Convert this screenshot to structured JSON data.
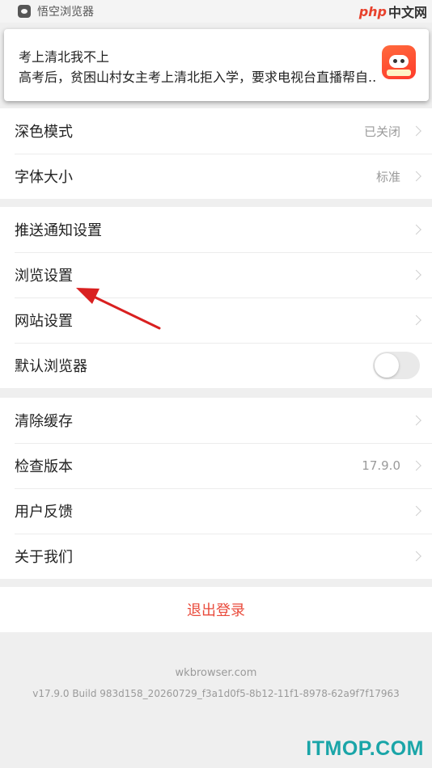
{
  "status_bar": {
    "app_name": "悟空浏览器",
    "app_icon": "app-icon"
  },
  "watermark_top": {
    "php": "php",
    "cn": "中文网"
  },
  "notification": {
    "title": "考上清北我不上",
    "body": "高考后，贫困山村女主考上清北拒入学，要求电视台直播帮自..",
    "icon": "app-promo-icon",
    "icon_color": "#ff4a31"
  },
  "display_group": {
    "items": [
      {
        "label": "深色模式",
        "value": "已关闭"
      },
      {
        "label": "字体大小",
        "value": "标准"
      }
    ]
  },
  "settings_group": {
    "items": [
      {
        "label": "推送通知设置"
      },
      {
        "label": "浏览设置"
      },
      {
        "label": "网站设置"
      },
      {
        "label": "默认浏览器",
        "toggle": false
      }
    ]
  },
  "misc_group": {
    "items": [
      {
        "label": "清除缓存"
      },
      {
        "label": "检查版本",
        "value": "17.9.0"
      },
      {
        "label": "用户反馈"
      },
      {
        "label": "关于我们"
      }
    ]
  },
  "logout_label": "退出登录",
  "footer": {
    "host": "wkbrowser.com",
    "build": "v17.9.0 Build 983d158_20260729_f3a1d0f5-8b12-11f1-8978-62a9f7f17963"
  },
  "watermark_bottom": "ITMOP.COM",
  "colors": {
    "accent_red": "#e94b3c",
    "annotation_arrow": "#d92020",
    "watermark_teal": "#1aa5a8"
  }
}
